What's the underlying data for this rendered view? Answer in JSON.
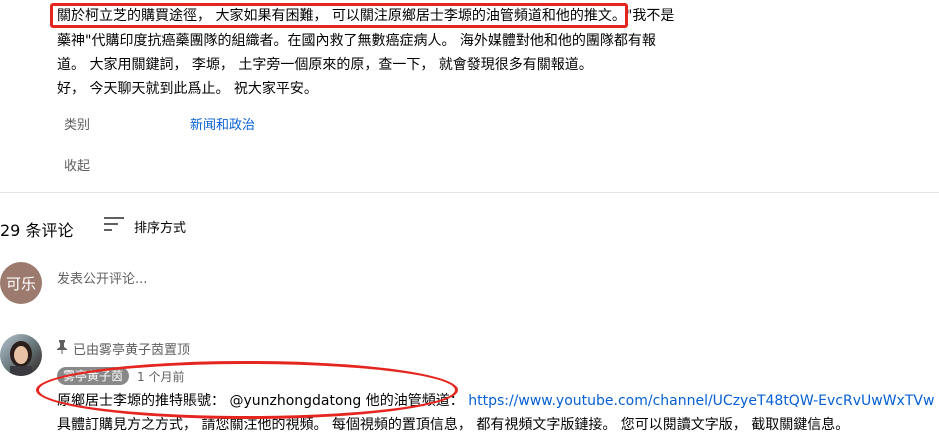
{
  "description": {
    "line1_highlight": "關於柯立芝的購買途徑， 大家如果有困難， 可以關注原鄉居士李塬的油管頻道和他的推文。",
    "line1_tail": "\"我不是",
    "line2": "藥神\"代購印度抗癌藥團隊的組織者。在國內救了無數癌症病人。 海外媒體對他和他的團隊都有報",
    "line3": "道。 大家用關鍵詞， 李塬， 土字旁一個原來的原，查一下， 就會發現很多有關報道。",
    "line4": "好， 今天聊天就到此爲止。 祝大家平安。",
    "category_label": "类别",
    "category_value": "新闻和政治",
    "collapse_label": "收起"
  },
  "comments": {
    "count_label": "29 条评论",
    "sort_label": "排序方式",
    "add_placeholder": "发表公开评论...",
    "user_avatar_text": "可乐"
  },
  "pinned_comment": {
    "pinned_text": "已由雾亭黄子茵置顶",
    "author": "雾亭黄子茵",
    "time": "1 个月前",
    "line1_text": "原鄉居士李塬的推特賬號： @yunzhongdatong  他的油管頻道： ",
    "line1_link": "https://www.youtube.com/channel/UCzyeT48tQW-EvcRvUwWxTVw",
    "line2": "具體訂購見方之方式， 請您關注他的視頻。 每個視頻的置頂信息， 都有視頻文字版鏈接。 您可以閱讀文字版， 截取關鍵信息。"
  },
  "colors": {
    "annotation_red": "#e52620",
    "link_blue": "#065fd4",
    "avatar_brown": "#9c7b6e"
  }
}
